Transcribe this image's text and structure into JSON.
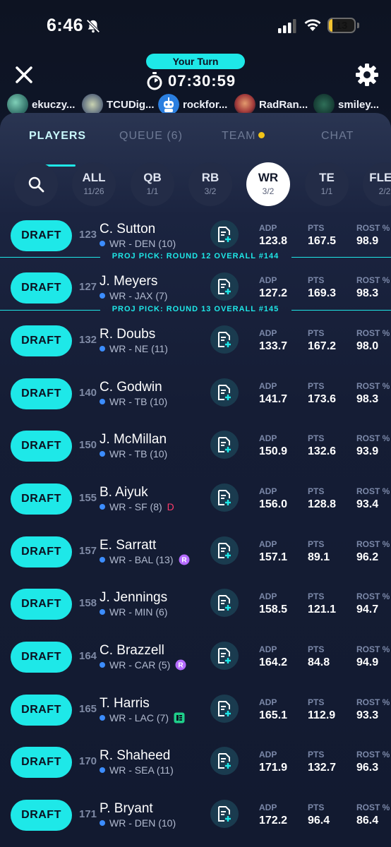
{
  "status": {
    "time": "6:46",
    "battery": "13",
    "battery_level_pct": 13
  },
  "header": {
    "turn_label": "Your Turn",
    "timer": "07:30:59"
  },
  "drafters": [
    {
      "name": "ekuczy..."
    },
    {
      "name": "TCUDig..."
    },
    {
      "name": "rockfor..."
    },
    {
      "name": "RadRan..."
    },
    {
      "name": "smiley..."
    }
  ],
  "tabs": {
    "players": "PLAYERS",
    "queue": "QUEUE (6)",
    "team": "TEAM",
    "chat": "CHAT"
  },
  "positions": [
    {
      "label": "ALL",
      "count": "11/26"
    },
    {
      "label": "QB",
      "count": "1/1"
    },
    {
      "label": "RB",
      "count": "3/2"
    },
    {
      "label": "WR",
      "count": "3/2",
      "active": true
    },
    {
      "label": "TE",
      "count": "1/1"
    },
    {
      "label": "FLEX",
      "count": "2/2"
    }
  ],
  "labels": {
    "draft": "DRAFT",
    "adp": "ADP",
    "pts": "PTS",
    "rost": "ROST %"
  },
  "proj_picks": [
    "PROJ PICK: ROUND 12 OVERALL #144",
    "PROJ PICK: ROUND 13 OVERALL #145"
  ],
  "players": [
    {
      "rank": "123",
      "name": "C. Sutton",
      "info": "WR - DEN (10)",
      "adp": "123.8",
      "pts": "167.5",
      "rost": "98.9"
    },
    {
      "rank": "127",
      "name": "J. Meyers",
      "info": "WR - JAX (7)",
      "adp": "127.2",
      "pts": "169.3",
      "rost": "98.3"
    },
    {
      "rank": "132",
      "name": "R. Doubs",
      "info": "WR - NE (11)",
      "adp": "133.7",
      "pts": "167.2",
      "rost": "98.0"
    },
    {
      "rank": "140",
      "name": "C. Godwin",
      "info": "WR - TB (10)",
      "adp": "141.7",
      "pts": "173.6",
      "rost": "98.3"
    },
    {
      "rank": "150",
      "name": "J. McMillan",
      "info": "WR - TB (10)",
      "adp": "150.9",
      "pts": "132.6",
      "rost": "93.9"
    },
    {
      "rank": "155",
      "name": "B. Aiyuk",
      "info": "WR - SF (8)",
      "flag": "D",
      "adp": "156.0",
      "pts": "128.8",
      "rost": "93.4"
    },
    {
      "rank": "157",
      "name": "E. Sarratt",
      "info": "WR - BAL (13)",
      "badge": "rookie",
      "adp": "157.1",
      "pts": "89.1",
      "rost": "96.2"
    },
    {
      "rank": "158",
      "name": "J. Jennings",
      "info": "WR - MIN (6)",
      "adp": "158.5",
      "pts": "121.1",
      "rost": "94.7"
    },
    {
      "rank": "164",
      "name": "C. Brazzell",
      "info": "WR - CAR (5)",
      "badge": "rookie",
      "adp": "164.2",
      "pts": "84.8",
      "rost": "94.9"
    },
    {
      "rank": "165",
      "name": "T. Harris",
      "info": "WR - LAC (7)",
      "badge": "note",
      "adp": "165.1",
      "pts": "112.9",
      "rost": "93.3"
    },
    {
      "rank": "170",
      "name": "R. Shaheed",
      "info": "WR - SEA (11)",
      "adp": "171.9",
      "pts": "132.7",
      "rost": "96.3"
    },
    {
      "rank": "171",
      "name": "P. Bryant",
      "info": "WR - DEN (10)",
      "adp": "172.2",
      "pts": "96.4",
      "rost": "86.4"
    }
  ],
  "colors": {
    "accent": "#1ee8e8",
    "team_dot": "#f2c418",
    "position_dot": "#3c8dff",
    "flag": "#ff3b6b",
    "rookie_badge": "#b56bff",
    "note_badge": "#1fcf8a"
  }
}
